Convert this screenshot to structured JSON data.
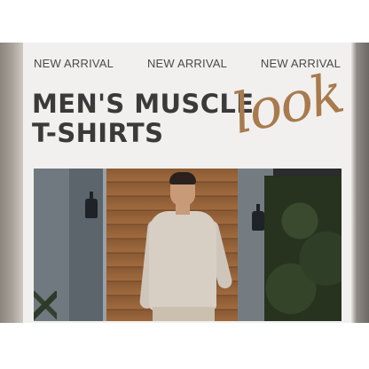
{
  "banner": {
    "ticker": [
      "NEW ARRIVAL",
      "NEW ARRIVAL",
      "NEW ARRIVAL"
    ],
    "headline_line1": "MEN'S MUSCLE",
    "headline_line2": "T-SHIRTS",
    "script_word": "look"
  },
  "colors": {
    "headline": "#3a3a3a",
    "script": "#a87a4e",
    "card_bg": "#f2f0ee"
  }
}
